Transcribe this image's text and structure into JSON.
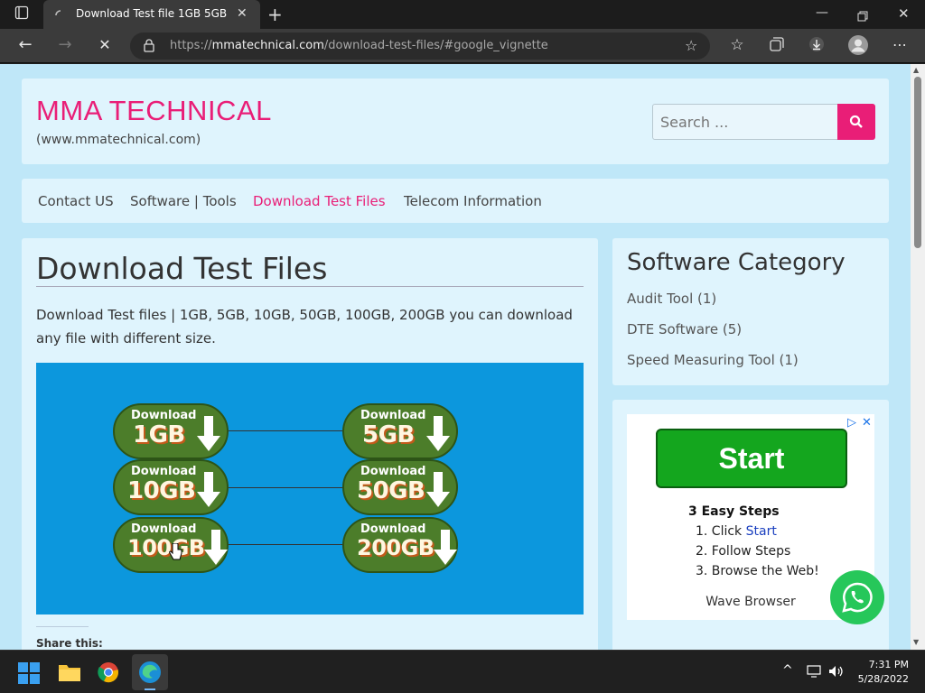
{
  "browser": {
    "tab_title": "Download Test file 1GB 5GB 10GB",
    "url_prefix": "https://",
    "url_host": "mmatechnical.com",
    "url_path": "/download-test-files/#google_vignette"
  },
  "site": {
    "title": "MMA TECHNICAL",
    "subtitle": "(www.mmatechnical.com)",
    "search_placeholder": "Search ..."
  },
  "nav": {
    "items": [
      {
        "label": "Contact US"
      },
      {
        "label": "Software | Tools"
      },
      {
        "label": "Download Test Files",
        "active": true
      },
      {
        "label": "Telecom Information"
      }
    ]
  },
  "article": {
    "title": "Download Test Files",
    "intro": "Download Test files | 1GB, 5GB, 10GB, 50GB, 100GB, 200GB you can download any file with different size.",
    "banner": {
      "download_label": "Download",
      "files": [
        {
          "size": "1GB"
        },
        {
          "size": "5GB"
        },
        {
          "size": "10GB"
        },
        {
          "size": "50GB"
        },
        {
          "size": "100GB"
        },
        {
          "size": "200GB"
        }
      ]
    },
    "share_label": "Share this:"
  },
  "sidebar": {
    "category_title": "Software Category",
    "categories": [
      {
        "label": "Audit Tool (1)"
      },
      {
        "label": "DTE Software (5)"
      },
      {
        "label": "Speed Measuring Tool (1)"
      }
    ]
  },
  "ad": {
    "start_label": "Start",
    "steps_title": "3 Easy Steps",
    "steps": [
      {
        "num": "1. Click",
        "link": "Start"
      },
      {
        "num": "2. Follow Steps"
      },
      {
        "num": "3. Browse the Web!"
      }
    ],
    "brand": "Wave Browser"
  },
  "taskbar": {
    "time": "7:31 PM",
    "date": "5/28/2022"
  },
  "colors": {
    "accent": "#e91e77",
    "page_bg": "#bfe7f8",
    "card_bg": "#dff4fd",
    "banner_bg": "#0c97dd",
    "ad_green": "#14a61e"
  }
}
